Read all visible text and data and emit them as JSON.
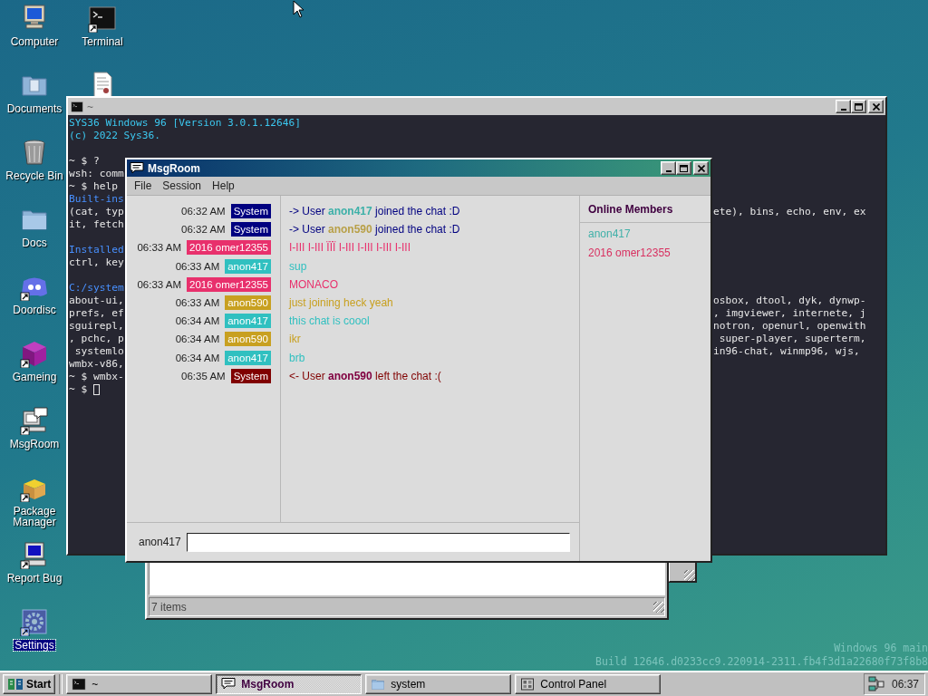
{
  "desktop_columns": [
    [
      {
        "label": "Computer",
        "kind": "computer",
        "shortcut": false,
        "selected": false
      },
      {
        "label": "Documents",
        "kind": "folder-docs",
        "shortcut": false,
        "selected": false
      },
      {
        "label": "Recycle Bin",
        "kind": "recycle",
        "shortcut": false,
        "selected": false
      },
      {
        "label": "Docs",
        "kind": "folder",
        "shortcut": false,
        "selected": false
      },
      {
        "label": "Doordisc",
        "kind": "blob",
        "shortcut": true,
        "selected": false
      },
      {
        "label": "Gameing",
        "kind": "cube",
        "shortcut": true,
        "selected": false
      },
      {
        "label": "MsgRoom",
        "kind": "chatpc",
        "shortcut": true,
        "selected": false
      },
      {
        "label": "Package Manager",
        "kind": "package",
        "shortcut": true,
        "selected": false
      },
      {
        "label": "Report Bug",
        "kind": "bugpc",
        "shortcut": true,
        "selected": false
      },
      {
        "label": "Settings",
        "kind": "settings",
        "shortcut": true,
        "selected": true
      }
    ],
    [
      {
        "label": "Terminal",
        "kind": "terminal",
        "shortcut": true,
        "selected": false
      },
      {
        "kind": "document"
      }
    ]
  ],
  "terminal_window": {
    "title": "~",
    "lines": [
      {
        "kind": "banner",
        "left": "SYS36 Windows 96 [Version 3.0.1.12646]"
      },
      {
        "kind": "banner",
        "left": "(c) 2022 Sys36."
      },
      {
        "kind": "blank"
      },
      {
        "kind": "plain",
        "left": "~ $ ?"
      },
      {
        "kind": "plain",
        "left": "wsh: comm"
      },
      {
        "kind": "plain",
        "left": "~ $ help"
      },
      {
        "kind": "heading",
        "left": "Built-ins"
      },
      {
        "kind": "plain",
        "left": "(cat, typ",
        "right": "ete), bins, echo, env, ex"
      },
      {
        "kind": "plain",
        "left": "it, fetch"
      },
      {
        "kind": "blank"
      },
      {
        "kind": "heading",
        "left": "Installed"
      },
      {
        "kind": "plain",
        "left": "ctrl, key"
      },
      {
        "kind": "blank"
      },
      {
        "kind": "heading",
        "left": "C:/system"
      },
      {
        "kind": "plain",
        "left": "about-ui,",
        "right": "osbox, dtool, dyk, dynwp-"
      },
      {
        "kind": "plain",
        "left": "prefs, ef",
        "right": ", imgviewer, internete, j"
      },
      {
        "kind": "plain",
        "left": "sguirepl,",
        "right": "notron, openurl, openwith"
      },
      {
        "kind": "plain",
        "left": ", pchc, p",
        "right": " super-player, superterm,"
      },
      {
        "kind": "plain",
        "left": " systemlo",
        "right": "in96-chat, winmp96, wjs,"
      },
      {
        "kind": "plain",
        "left": "wmbx-v86,"
      },
      {
        "kind": "plain",
        "left": "~ $ wmbx-"
      },
      {
        "kind": "prompt",
        "left": "~ $ "
      }
    ]
  },
  "msgroom_window": {
    "title": "MsgRoom",
    "menu": [
      "File",
      "Session",
      "Help"
    ],
    "messages": [
      {
        "kind": "system",
        "time": "06:32 AM",
        "user": "System",
        "color": "#000080",
        "prefix": "-> User",
        "mention": {
          "name": "anon417",
          "color": "#3cb0a8"
        },
        "suffix": "joined the chat :D"
      },
      {
        "kind": "system",
        "time": "06:32 AM",
        "user": "System",
        "color": "#000080",
        "prefix": "-> User",
        "mention": {
          "name": "anon590",
          "color": "#b8a048"
        },
        "suffix": "joined the chat :D"
      },
      {
        "kind": "user",
        "time": "06:33 AM",
        "user": "2016 omer12355",
        "color": "#e8306c",
        "text": "I-III I-III ÏÏÏ I-III I-III I-III I-III"
      },
      {
        "kind": "user",
        "time": "06:33 AM",
        "user": "anon417",
        "color": "#30c0c0",
        "text": "sup"
      },
      {
        "kind": "user",
        "time": "06:33 AM",
        "user": "2016 omer12355",
        "color": "#e8306c",
        "text": "MONACO"
      },
      {
        "kind": "user",
        "time": "06:33 AM",
        "user": "anon590",
        "color": "#c8a020",
        "text": "just joining heck yeah"
      },
      {
        "kind": "user",
        "time": "06:34 AM",
        "user": "anon417",
        "color": "#30c0c0",
        "text": "this chat is coool"
      },
      {
        "kind": "user",
        "time": "06:34 AM",
        "user": "anon590",
        "color": "#c8a020",
        "text": "ikr"
      },
      {
        "kind": "user",
        "time": "06:34 AM",
        "user": "anon417",
        "color": "#30c0c0",
        "text": "brb"
      },
      {
        "kind": "system",
        "time": "06:35 AM",
        "user": "System",
        "color": "#800000",
        "prefix": "<- User",
        "mention": {
          "name": "anon590",
          "color": "#800040"
        },
        "suffix": "left the chat :("
      }
    ],
    "members_title": "Online Members",
    "members": [
      {
        "name": "anon417",
        "color": "#40b0a8"
      },
      {
        "name": "2016 omer12355",
        "color": "#d83060"
      }
    ],
    "input_label": "anon417"
  },
  "explorer_window": {
    "status": "7 items"
  },
  "build_info": [
    "Windows 96 main",
    "Build 12646.d0233cc9.220914-2311.fb4f3d1a22680f73f8b8"
  ],
  "taskbar": {
    "start": "Start",
    "buttons": [
      {
        "label": "~",
        "kind": "terminal",
        "selected": false
      },
      {
        "label": "MsgRoom",
        "kind": "chat",
        "selected": true
      },
      {
        "label": "system",
        "kind": "folder",
        "selected": false
      },
      {
        "label": "Control Panel",
        "kind": "panel",
        "selected": false
      }
    ],
    "clock": "06:37"
  }
}
